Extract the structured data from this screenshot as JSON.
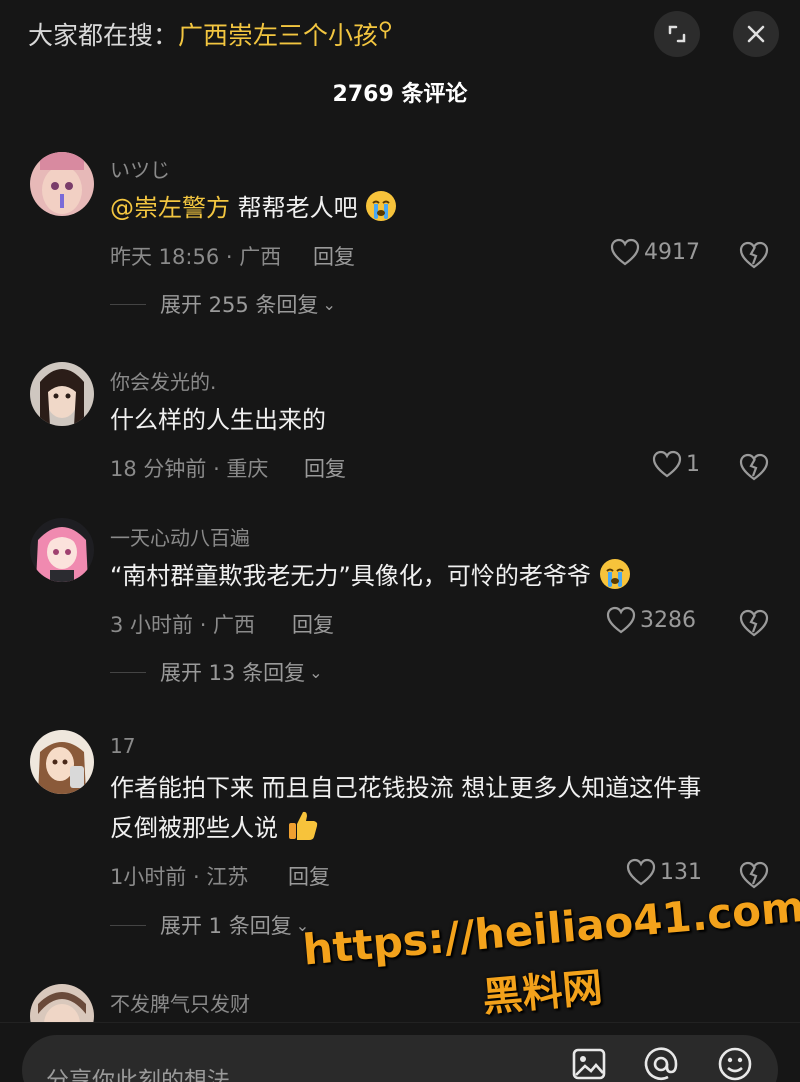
{
  "header": {
    "search_prefix": "大家都在搜：",
    "search_keyword": "广西崇左三个小孩",
    "comment_count_title": "2769 条评论"
  },
  "comments": [
    {
      "username": "いツじ",
      "mention": "@崇左警方",
      "text": " 帮帮老人吧",
      "time_location": "昨天 18:56 · 广西",
      "reply_label": "回复",
      "likes": "4917",
      "expand_label": "展开 255 条回复"
    },
    {
      "username": "你会发光的.",
      "text": "什么样的人生出来的",
      "time_location": "18 分钟前 · 重庆",
      "reply_label": "回复",
      "likes": "1"
    },
    {
      "username": "一天心动八百遍",
      "text": "“南村群童欺我老无力”具像化，可怜的老爷爷",
      "time_location": "3 小时前 · 广西",
      "reply_label": "回复",
      "likes": "3286",
      "expand_label": "展开 13 条回复"
    },
    {
      "username": "17",
      "text_line1": "作者能拍下来 而且自己花钱投流  想让更多人知道这件事",
      "text_line2": "反倒被那些人说",
      "time_location": "1小时前 · 江苏",
      "reply_label": "回复",
      "likes": "131",
      "expand_label": "展开 1 条回复"
    },
    {
      "username": "不发脾气只发财"
    }
  ],
  "input": {
    "placeholder": "分享你此刻的想法"
  },
  "watermark": {
    "line1": "https://heiliao41.com",
    "line2": "黑料网"
  },
  "colors": {
    "accent": "#f3c640",
    "background": "#161616",
    "watermark": "#f3a21b"
  }
}
